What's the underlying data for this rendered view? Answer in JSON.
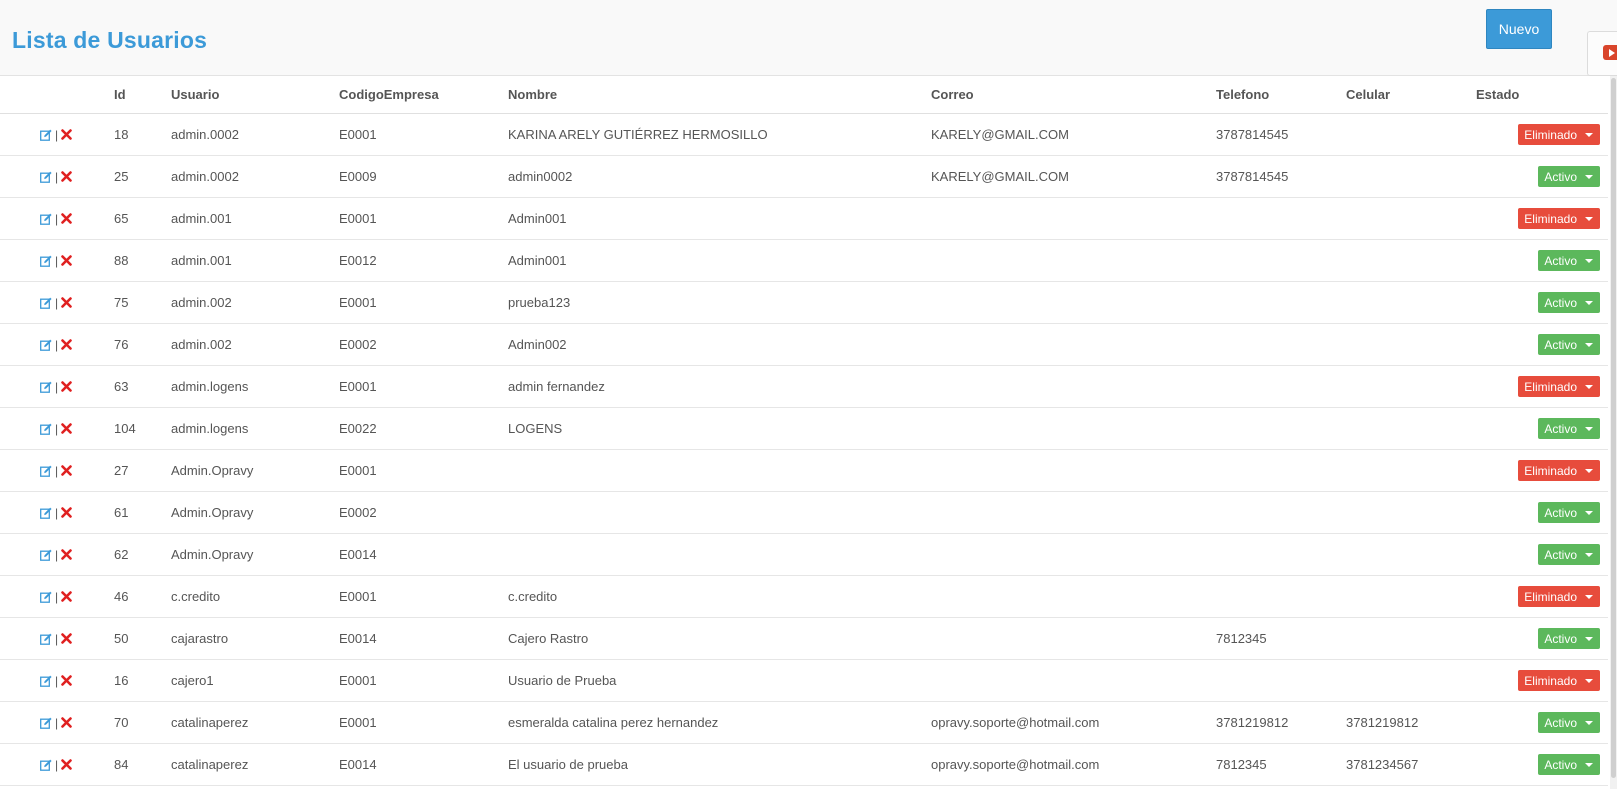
{
  "header": {
    "title": "Lista de Usuarios",
    "new_label": "Nuevo"
  },
  "colors": {
    "accent": "#3c9ad8",
    "status_activo": "#5cb85c",
    "status_eliminado": "#e74c3c",
    "edit_icon": "#3c9ad8",
    "delete_icon": "#e02020"
  },
  "table": {
    "columns": [
      "Id",
      "Usuario",
      "CodigoEmpresa",
      "Nombre",
      "Correo",
      "Telefono",
      "Celular",
      "Estado"
    ],
    "rows": [
      {
        "id": "18",
        "usuario": "admin.0002",
        "codigo": "E0001",
        "nombre": "KARINA ARELY GUTIÉRREZ HERMOSILLO",
        "correo": "KARELY@GMAIL.COM",
        "telefono": "3787814545",
        "celular": "",
        "estado": "Eliminado"
      },
      {
        "id": "25",
        "usuario": "admin.0002",
        "codigo": "E0009",
        "nombre": "admin0002",
        "correo": "KARELY@GMAIL.COM",
        "telefono": "3787814545",
        "celular": "",
        "estado": "Activo"
      },
      {
        "id": "65",
        "usuario": "admin.001",
        "codigo": "E0001",
        "nombre": "Admin001",
        "correo": "",
        "telefono": "",
        "celular": "",
        "estado": "Eliminado"
      },
      {
        "id": "88",
        "usuario": "admin.001",
        "codigo": "E0012",
        "nombre": "Admin001",
        "correo": "",
        "telefono": "",
        "celular": "",
        "estado": "Activo"
      },
      {
        "id": "75",
        "usuario": "admin.002",
        "codigo": "E0001",
        "nombre": "prueba123",
        "correo": "",
        "telefono": "",
        "celular": "",
        "estado": "Activo"
      },
      {
        "id": "76",
        "usuario": "admin.002",
        "codigo": "E0002",
        "nombre": "Admin002",
        "correo": "",
        "telefono": "",
        "celular": "",
        "estado": "Activo"
      },
      {
        "id": "63",
        "usuario": "admin.logens",
        "codigo": "E0001",
        "nombre": "admin fernandez",
        "correo": "",
        "telefono": "",
        "celular": "",
        "estado": "Eliminado"
      },
      {
        "id": "104",
        "usuario": "admin.logens",
        "codigo": "E0022",
        "nombre": "LOGENS",
        "correo": "",
        "telefono": "",
        "celular": "",
        "estado": "Activo"
      },
      {
        "id": "27",
        "usuario": "Admin.Opravy",
        "codigo": "E0001",
        "nombre": "",
        "correo": "",
        "telefono": "",
        "celular": "",
        "estado": "Eliminado"
      },
      {
        "id": "61",
        "usuario": "Admin.Opravy",
        "codigo": "E0002",
        "nombre": "",
        "correo": "",
        "telefono": "",
        "celular": "",
        "estado": "Activo"
      },
      {
        "id": "62",
        "usuario": "Admin.Opravy",
        "codigo": "E0014",
        "nombre": "",
        "correo": "",
        "telefono": "",
        "celular": "",
        "estado": "Activo"
      },
      {
        "id": "46",
        "usuario": "c.credito",
        "codigo": "E0001",
        "nombre": "c.credito",
        "correo": "",
        "telefono": "",
        "celular": "",
        "estado": "Eliminado"
      },
      {
        "id": "50",
        "usuario": "cajarastro",
        "codigo": "E0014",
        "nombre": "Cajero Rastro",
        "correo": "",
        "telefono": "7812345",
        "celular": "",
        "estado": "Activo"
      },
      {
        "id": "16",
        "usuario": "cajero1",
        "codigo": "E0001",
        "nombre": "Usuario de Prueba",
        "correo": "",
        "telefono": "",
        "celular": "",
        "estado": "Eliminado"
      },
      {
        "id": "70",
        "usuario": "catalinaperez",
        "codigo": "E0001",
        "nombre": "esmeralda catalina perez hernandez",
        "correo": "opravy.soporte@hotmail.com",
        "telefono": "3781219812",
        "celular": "3781219812",
        "estado": "Activo"
      },
      {
        "id": "84",
        "usuario": "catalinaperez",
        "codigo": "E0014",
        "nombre": "El usuario de prueba",
        "correo": "opravy.soporte@hotmail.com",
        "telefono": "7812345",
        "celular": "3781234567",
        "estado": "Activo"
      }
    ]
  },
  "row_action_separator": "|"
}
